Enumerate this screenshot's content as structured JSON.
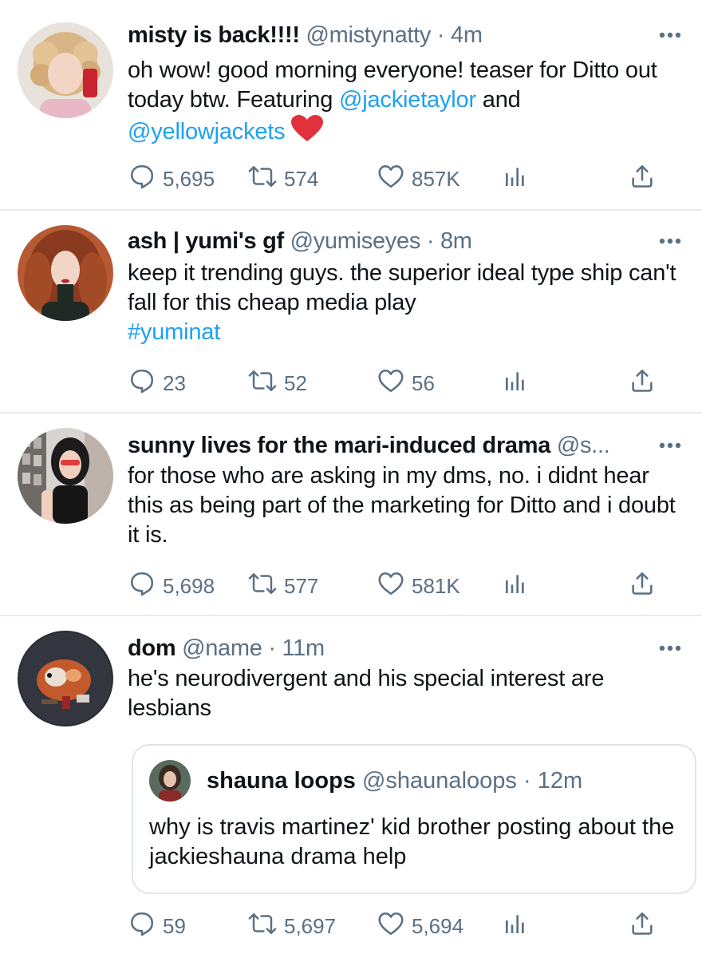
{
  "colors": {
    "link": "#1da1f2",
    "muted": "#5b7083",
    "text": "#0f1419",
    "divider": "#e6ecf0"
  },
  "icons": {
    "reply": "reply-icon",
    "retweet": "retweet-icon",
    "like": "heart-icon",
    "analytics": "analytics-icon",
    "share": "share-icon",
    "more": "more-icon"
  },
  "tweets": [
    {
      "name": "misty is back!!!!",
      "handle": "@mistynatty",
      "sep": "·",
      "time": "4m",
      "text_1": "oh wow! good morning everyone! teaser for Ditto out today btw. Featuring ",
      "mention_1": "@jackietaylor",
      "text_2": " and ",
      "mention_2": "@yellowjackets",
      "emoji": "❤️",
      "replies": "5,695",
      "retweets": "574",
      "likes": "857K"
    },
    {
      "name": "ash | yumi's gf",
      "handle": "@yumiseyes",
      "sep": "·",
      "time": "8m",
      "text_1": "keep it trending guys. the superior ideal type ship can't fall for this cheap media play",
      "hashtag": "#yuminat",
      "replies": "23",
      "retweets": "52",
      "likes": "56"
    },
    {
      "name": "sunny lives for the mari-induced drama",
      "handle": "@s...",
      "text_1": "for those who are asking in my dms, no. i didnt hear this as being part of the marketing for Ditto and i doubt it is.",
      "replies": "5,698",
      "retweets": "577",
      "likes": "581K"
    },
    {
      "name": "dom",
      "handle": "@name",
      "sep": "·",
      "time": "11m",
      "text_1": "he's neurodivergent and his special interest are lesbians",
      "quote": {
        "name": "shauna loops",
        "handle": "@shaunaloops",
        "sep": "·",
        "time": "12m",
        "text": "why is travis martinez' kid brother posting about the jackieshauna drama help"
      },
      "replies": "59",
      "retweets": "5,697",
      "likes": "5,694"
    }
  ]
}
